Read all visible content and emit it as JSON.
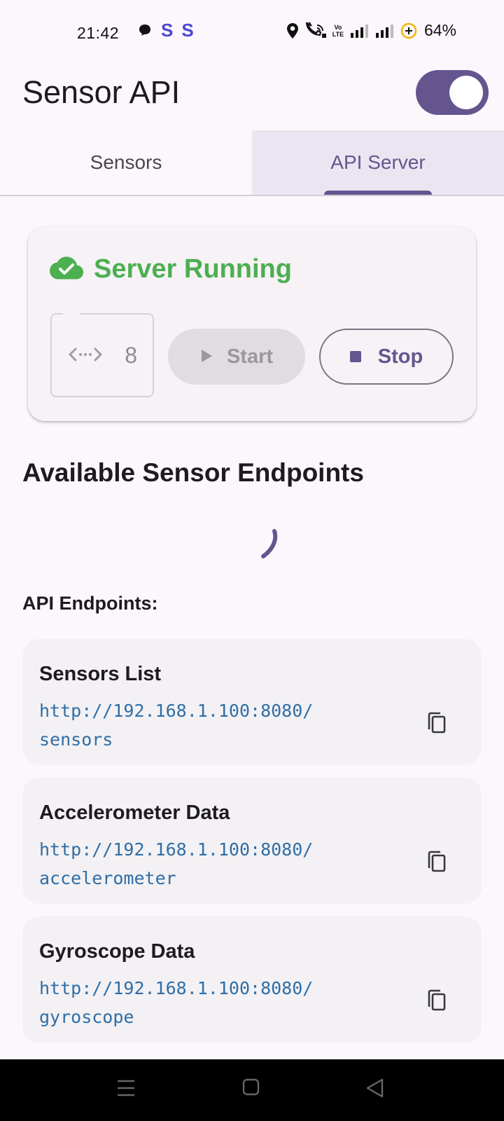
{
  "status_bar": {
    "time": "21:42",
    "s1": "S",
    "s2": "S",
    "volte_top": "Vo",
    "volte_bottom": "LTE",
    "battery": "64%"
  },
  "app_bar": {
    "title": "Sensor API",
    "toggle_on": true
  },
  "tabs": [
    {
      "label": "Sensors",
      "active": false
    },
    {
      "label": "API Server",
      "active": true
    }
  ],
  "server_card": {
    "status": "Server Running",
    "status_color": "#4caf50",
    "port_value": "8",
    "start_label": "Start",
    "stop_label": "Stop"
  },
  "section_title": "Available Sensor Endpoints",
  "endpoints_label": "API Endpoints:",
  "endpoints": [
    {
      "name": "Sensors List",
      "url": "http://192.168.1.100:8080/sensors"
    },
    {
      "name": "Accelerometer Data",
      "url": "http://192.168.1.100:8080/accelerometer"
    },
    {
      "name": "Gyroscope Data",
      "url": "http://192.168.1.100:8080/gyroscope"
    }
  ],
  "colors": {
    "accent": "#65558f",
    "background": "#fcf7fc",
    "link": "#2f6ea6"
  }
}
